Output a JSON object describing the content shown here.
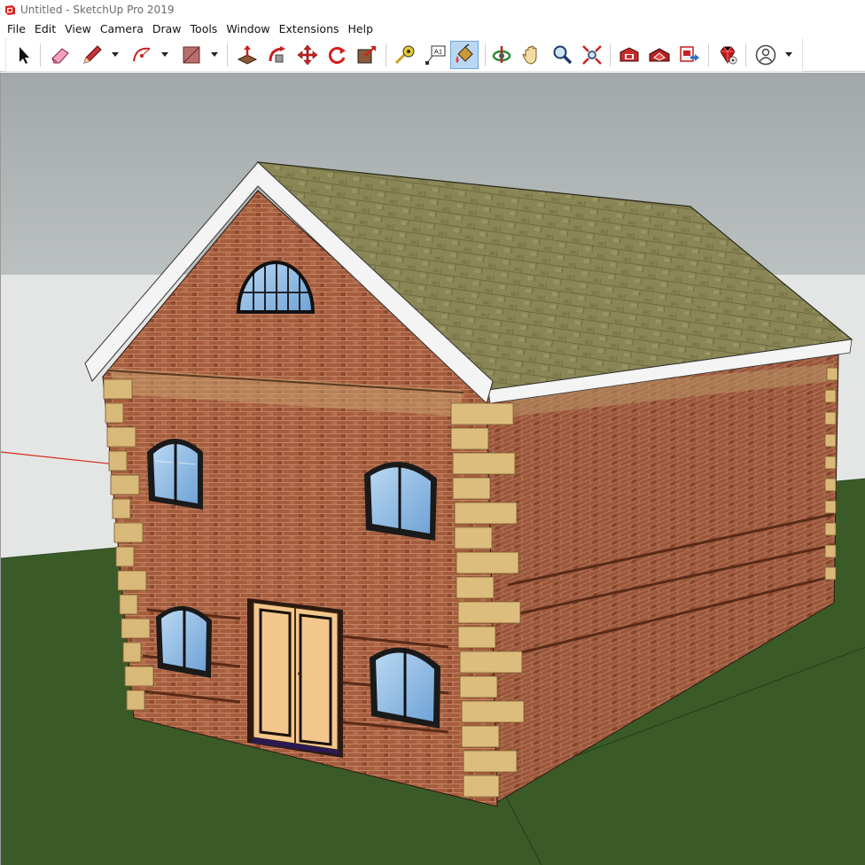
{
  "window": {
    "title": "Untitled - SketchUp Pro 2019"
  },
  "menu": [
    {
      "label": "File"
    },
    {
      "label": "Edit"
    },
    {
      "label": "View"
    },
    {
      "label": "Camera"
    },
    {
      "label": "Draw"
    },
    {
      "label": "Tools"
    },
    {
      "label": "Window"
    },
    {
      "label": "Extensions"
    },
    {
      "label": "Help"
    }
  ],
  "toolbar": {
    "tools": [
      {
        "name": "select-tool",
        "icon": "arrow-cursor-icon"
      },
      {
        "name": "eraser-tool",
        "icon": "eraser-icon"
      },
      {
        "name": "line-tool",
        "icon": "pencil-icon"
      },
      {
        "name": "arc-tool",
        "icon": "arc-icon"
      },
      {
        "name": "rectangle-tool",
        "icon": "rectangle-icon"
      },
      {
        "name": "push-pull-tool",
        "icon": "push-pull-icon"
      },
      {
        "name": "follow-me-tool",
        "icon": "follow-me-icon"
      },
      {
        "name": "move-tool",
        "icon": "move-arrows-icon"
      },
      {
        "name": "rotate-tool",
        "icon": "rotate-icon"
      },
      {
        "name": "scale-tool",
        "icon": "scale-icon"
      },
      {
        "name": "tape-measure-tool",
        "icon": "tape-measure-icon"
      },
      {
        "name": "text-tool",
        "icon": "text-label-icon"
      },
      {
        "name": "paint-bucket-tool",
        "icon": "paint-bucket-icon"
      },
      {
        "name": "orbit-tool",
        "icon": "orbit-icon"
      },
      {
        "name": "pan-tool",
        "icon": "hand-icon"
      },
      {
        "name": "zoom-tool",
        "icon": "magnifier-icon"
      },
      {
        "name": "zoom-extents-tool",
        "icon": "zoom-extents-icon"
      },
      {
        "name": "3d-warehouse-button",
        "icon": "warehouse-icon"
      },
      {
        "name": "extension-warehouse-button",
        "icon": "extension-warehouse-icon"
      },
      {
        "name": "send-to-layout-button",
        "icon": "layout-icon"
      },
      {
        "name": "extension-manager-button",
        "icon": "ruby-gem-icon"
      },
      {
        "name": "account-button",
        "icon": "user-account-icon"
      }
    ],
    "text_tool_glyph": "A1"
  },
  "scene": {
    "colors": {
      "sky_top": "#a3a9ab",
      "sky_bottom": "#e9eceb",
      "ground": "#3a5a28",
      "brick": "#a25c3e",
      "roof": "#8a8557",
      "quoin": "#d9b97a",
      "fascia": "#f4f4f4",
      "glass": "#8ab7e0",
      "door": "#f3c78c",
      "red_axis": "#d4281a"
    }
  }
}
